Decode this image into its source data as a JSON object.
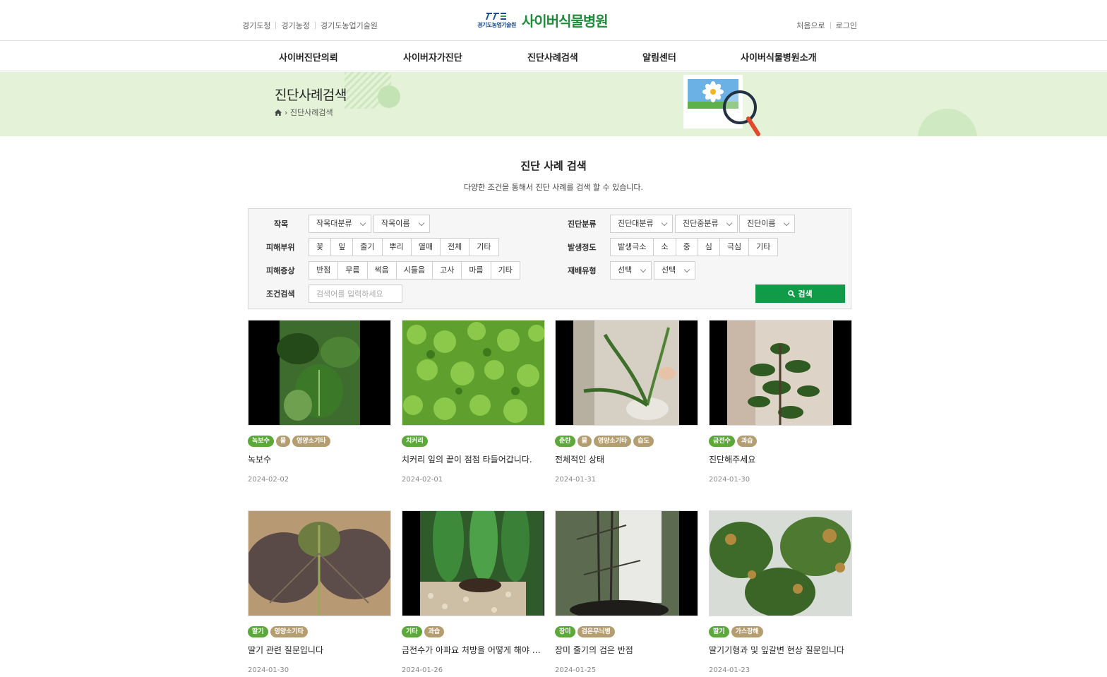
{
  "header": {
    "top_links": [
      "경기도청",
      "경기농정",
      "경기도농업기술원"
    ],
    "logo_org": "경기도농업기술원",
    "logo_title": "사이버식물병원",
    "user_links": [
      "처음으로",
      "로그인"
    ]
  },
  "nav": [
    "사이버진단의뢰",
    "사이버자가진단",
    "진단사례검색",
    "알림센터",
    "사이버식물병원소개"
  ],
  "subvisual": {
    "title": "진단사례검색",
    "breadcrumb": "진단사례검색"
  },
  "main": {
    "title": "진단 사례 검색",
    "description": "다양한 조건을 통해서 진단 사례를 검색 할 수 있습니다."
  },
  "search": {
    "crop_label": "작목",
    "crop_major": "작목대분류",
    "crop_name": "작목이름",
    "diag_label": "진단분류",
    "diag_major": "진단대분류",
    "diag_middle": "진단중분류",
    "diag_name": "진단이름",
    "part_label": "피해부위",
    "parts": [
      "꽃",
      "잎",
      "줄기",
      "뿌리",
      "열매",
      "전체",
      "기타"
    ],
    "severity_label": "발생정도",
    "severity": [
      "발생극소",
      "소",
      "중",
      "심",
      "극심",
      "기타"
    ],
    "symptom_label": "피해증상",
    "symptoms": [
      "반점",
      "무름",
      "썩음",
      "시들음",
      "고사",
      "마름",
      "기타"
    ],
    "cultivation_label": "재배유형",
    "cultivation_select1": "선택",
    "cultivation_select2": "선택",
    "keyword_label": "조건검색",
    "keyword_placeholder": "검색어를 입력하세요",
    "button": "검색"
  },
  "cards": [
    {
      "tags": [
        {
          "t": "녹보수",
          "c": "g"
        },
        {
          "t": "물",
          "c": "b"
        },
        {
          "t": "영양소기타",
          "c": "b"
        }
      ],
      "title": "녹보수",
      "date": "2024-02-02"
    },
    {
      "tags": [
        {
          "t": "치커리",
          "c": "g"
        }
      ],
      "title": "치커리 잎의 끝이 점점 타들어갑니다.",
      "date": "2024-02-01"
    },
    {
      "tags": [
        {
          "t": "춘란",
          "c": "g"
        },
        {
          "t": "물",
          "c": "b"
        },
        {
          "t": "영양소기타",
          "c": "b"
        },
        {
          "t": "습도",
          "c": "b"
        }
      ],
      "title": "전체적인 상태",
      "date": "2024-01-31"
    },
    {
      "tags": [
        {
          "t": "금전수",
          "c": "g"
        },
        {
          "t": "과습",
          "c": "b"
        }
      ],
      "title": "진단해주세요",
      "date": "2024-01-30"
    },
    {
      "tags": [
        {
          "t": "딸기",
          "c": "g"
        },
        {
          "t": "영양소기타",
          "c": "b"
        }
      ],
      "title": "딸기 관련 질문입니다",
      "date": "2024-01-30"
    },
    {
      "tags": [
        {
          "t": "기타",
          "c": "g"
        },
        {
          "t": "과습",
          "c": "b"
        }
      ],
      "title": "금전수가 아파요 처방을 어떻게 해야 할까요",
      "date": "2024-01-26"
    },
    {
      "tags": [
        {
          "t": "장미",
          "c": "g"
        },
        {
          "t": "검은무늬병",
          "c": "b"
        }
      ],
      "title": "장미 줄기의 검은 반점",
      "date": "2024-01-25"
    },
    {
      "tags": [
        {
          "t": "딸기",
          "c": "g"
        },
        {
          "t": "가스장해",
          "c": "b"
        }
      ],
      "title": "딸기기형과 및 잎갈변 현상 질문입니다",
      "date": "2024-01-23"
    }
  ],
  "colors": {
    "brand_green": "#0f9b48",
    "tag_green": "#5da83b",
    "tag_beige": "#b49e71",
    "subvisual_bg": "#e4f2d8"
  }
}
